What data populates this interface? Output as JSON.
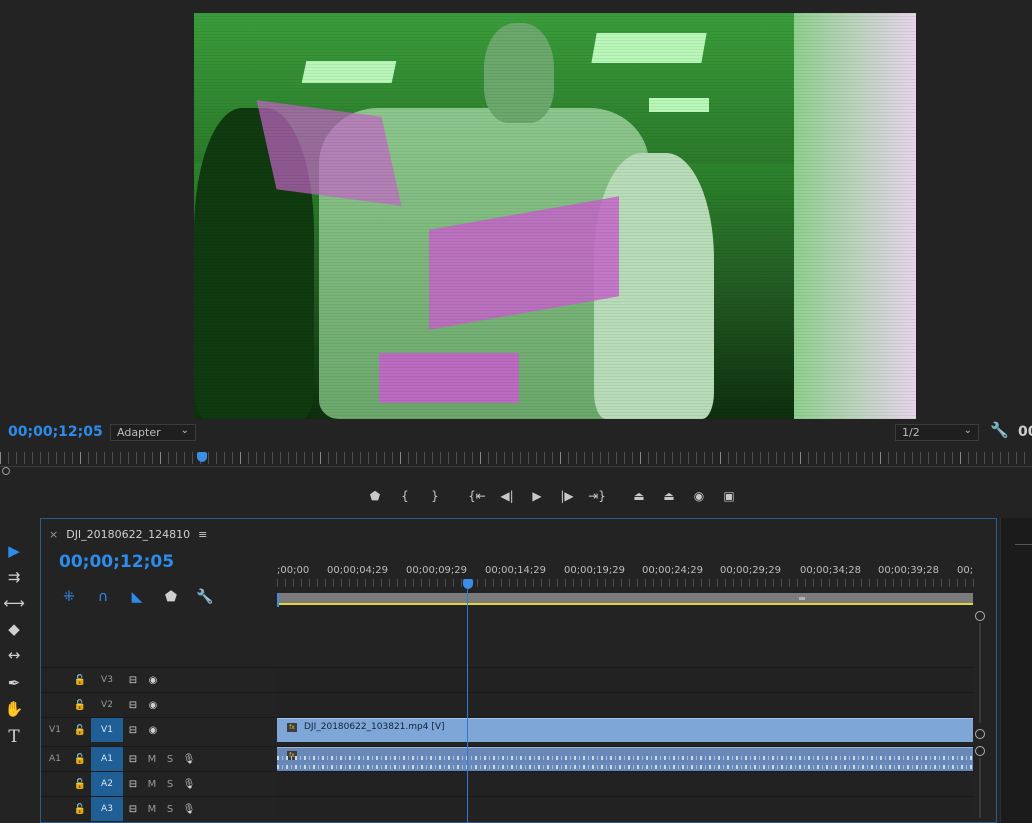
{
  "program_monitor": {
    "timecode": "00;00;12;05",
    "fit_selector": "Adapter",
    "resolution_selector": "1/2",
    "right_timecode_partial": "00",
    "transport_buttons": [
      {
        "name": "add-marker",
        "glyph": "⬟"
      },
      {
        "name": "mark-in",
        "glyph": "{"
      },
      {
        "name": "mark-out",
        "glyph": "}"
      },
      {
        "name": "go-to-in",
        "glyph": "{⇤"
      },
      {
        "name": "step-back",
        "glyph": "◀|"
      },
      {
        "name": "play",
        "glyph": "▶"
      },
      {
        "name": "step-forward",
        "glyph": "|▶"
      },
      {
        "name": "go-to-out",
        "glyph": "⇥}"
      },
      {
        "name": "lift",
        "glyph": "⏏"
      },
      {
        "name": "extract",
        "glyph": "⏏"
      },
      {
        "name": "export-frame",
        "glyph": "◉"
      },
      {
        "name": "compare-view",
        "glyph": "▣"
      }
    ]
  },
  "tools": [
    {
      "name": "selection-tool",
      "glyph": "▶",
      "active": true
    },
    {
      "name": "track-select-tool",
      "glyph": "⇉"
    },
    {
      "name": "ripple-edit-tool",
      "glyph": "⟷"
    },
    {
      "name": "razor-tool",
      "glyph": "◆"
    },
    {
      "name": "slip-tool",
      "glyph": "↔"
    },
    {
      "name": "pen-tool",
      "glyph": "✒"
    },
    {
      "name": "hand-tool",
      "glyph": "✋"
    },
    {
      "name": "type-tool",
      "glyph": "T"
    }
  ],
  "timeline": {
    "sequence_name": "DJI_20180622_124810",
    "close_glyph": "×",
    "menu_glyph": "≡",
    "timecode": "00;00;12;05",
    "ruler_labels": [
      ";00;00",
      "00;00;04;29",
      "00;00;09;29",
      "00;00;14;29",
      "00;00;19;29",
      "00;00;24;29",
      "00;00;29;29",
      "00;00;34;28",
      "00;00;39;28",
      "00;"
    ],
    "tracks": {
      "v3": {
        "name": "V3",
        "source": ""
      },
      "v2": {
        "name": "V2",
        "source": ""
      },
      "v1": {
        "name": "V1",
        "source": "V1"
      },
      "a1": {
        "name": "A1",
        "source": "A1"
      },
      "a2": {
        "name": "A2",
        "source": ""
      },
      "a3": {
        "name": "A3",
        "source": ""
      }
    },
    "mute_label": "M",
    "solo_label": "S",
    "video_clip": {
      "fx": "fx",
      "label": "DJI_20180622_103821.mp4 [V]"
    },
    "audio_clip": {
      "fx": "fx"
    }
  },
  "colors": {
    "accent": "#2d8ceb",
    "video_clip": "#7ea6d6",
    "audio_clip": "#6888b8",
    "work_area_bar": "#e4d43a",
    "active_track": "#1f5f95"
  }
}
